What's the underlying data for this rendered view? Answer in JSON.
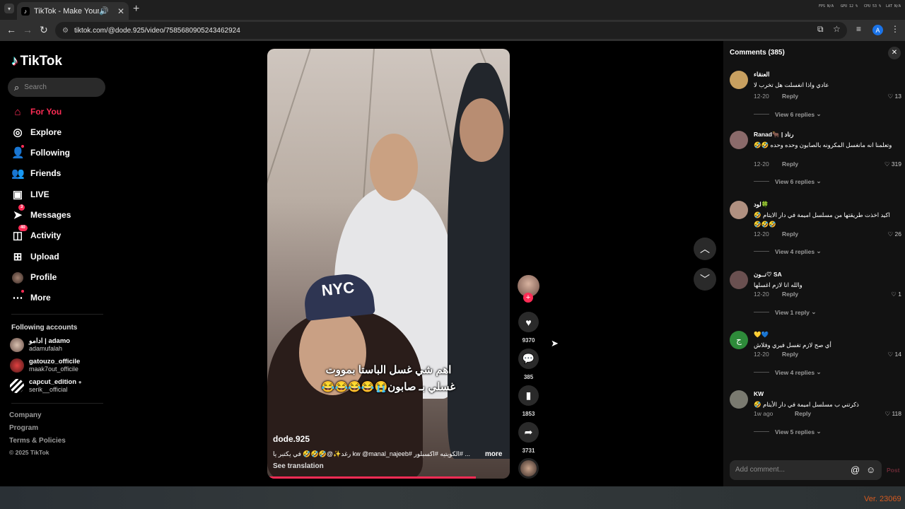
{
  "browser": {
    "tab_title": "TikTok - Make Your Day",
    "url": "tiktok.com/@dode.925/video/7585680905243462924",
    "profile_initial": "A",
    "perf": [
      "FPS N/A",
      "GPU 12 %",
      "CPU 53 %",
      "LAT N/A"
    ]
  },
  "sidebar": {
    "logo": "TikTok",
    "search_placeholder": "Search",
    "nav": [
      {
        "label": "For You",
        "icon": "home-icon"
      },
      {
        "label": "Explore",
        "icon": "compass-icon"
      },
      {
        "label": "Following",
        "icon": "following-icon"
      },
      {
        "label": "Friends",
        "icon": "friends-icon"
      },
      {
        "label": "LIVE",
        "icon": "live-icon"
      },
      {
        "label": "Messages",
        "icon": "messages-icon",
        "badge": "3"
      },
      {
        "label": "Activity",
        "icon": "activity-icon",
        "badge": "40"
      },
      {
        "label": "Upload",
        "icon": "upload-icon"
      },
      {
        "label": "Profile",
        "icon": "profile-avatar"
      },
      {
        "label": "More",
        "icon": "more-icon"
      }
    ],
    "following_title": "Following accounts",
    "following": [
      {
        "name": "ادامو | adamo",
        "handle": "adamufalah"
      },
      {
        "name": "gatouzo_officile",
        "handle": "maak7out_officile"
      },
      {
        "name": "capcut_edition",
        "handle": "serik__official"
      }
    ],
    "footer": [
      "Company",
      "Program",
      "Terms & Policies",
      "© 2025 TikTok"
    ]
  },
  "video": {
    "caption_line1": "اهم شي غسل الباستا بمووت",
    "caption_line2": "غسلي بـ صابون😭😂😂😂😂",
    "cap_text": "NYC",
    "username": "dode.925",
    "description": "... #الكويتيه #اكسبلور #kw @manal_najeeb رغد✨@🤣🤣🤣 في يكتبر يا",
    "more": "more",
    "see_translation": "See translation",
    "progress_fraction": 0.86
  },
  "actions": {
    "likes": "9370",
    "comments": "385",
    "saves": "1853",
    "shares": "3731"
  },
  "comments": {
    "title": "Comments (385)",
    "input_placeholder": "Add comment...",
    "post_label": "Post",
    "reply_label": "Reply",
    "items": [
      {
        "user": "العنقاء",
        "text": "عادي واذا انغسلت هل تخرب لا",
        "date": "12-20",
        "likes": "13",
        "view_replies": "View 6 replies",
        "avatar_color": "#c8a060"
      },
      {
        "user": "Ranad🐂 | رناد",
        "text": "وتعلمنا انه مانغسل المكرونه بالصابون وحده وحده 🤣🤣",
        "date": "12-20",
        "likes": "319",
        "view_replies": "View 6 replies",
        "avatar_color": "#8a6a6a"
      },
      {
        "user": "لود🍀",
        "text": "اكيد اخذت طريقتها من مسلسل اميمة في دار الايتام 🤣🤣🤣🤣",
        "date": "12-20",
        "likes": "26",
        "view_replies": "View 4 replies",
        "avatar_color": "#b09080"
      },
      {
        "user": "نــون♡ SA",
        "text": "والله انا لازم اغسلها",
        "date": "12-20",
        "likes": "1",
        "view_replies": "View 1 reply",
        "avatar_color": "#6a5050"
      },
      {
        "user": "💛💙",
        "text": "أي صح لازم تغسل فيري وفلاش",
        "date": "12-20",
        "likes": "14",
        "view_replies": "View 4 replies",
        "avatar_color": "#2e8b3a",
        "avatar_letter": "ج"
      },
      {
        "user": "KW",
        "text": "ذكرتني ب مسلسل اميمة في دار الأيتام 🤣",
        "date": "1w ago",
        "likes": "118",
        "view_replies": "View 5 replies",
        "avatar_color": "#7a7a70"
      }
    ]
  },
  "footer_version": "Ver. 23069",
  "colors": {
    "accent": "#fe2c55",
    "panel": "#121212",
    "chrome": "#303030"
  }
}
